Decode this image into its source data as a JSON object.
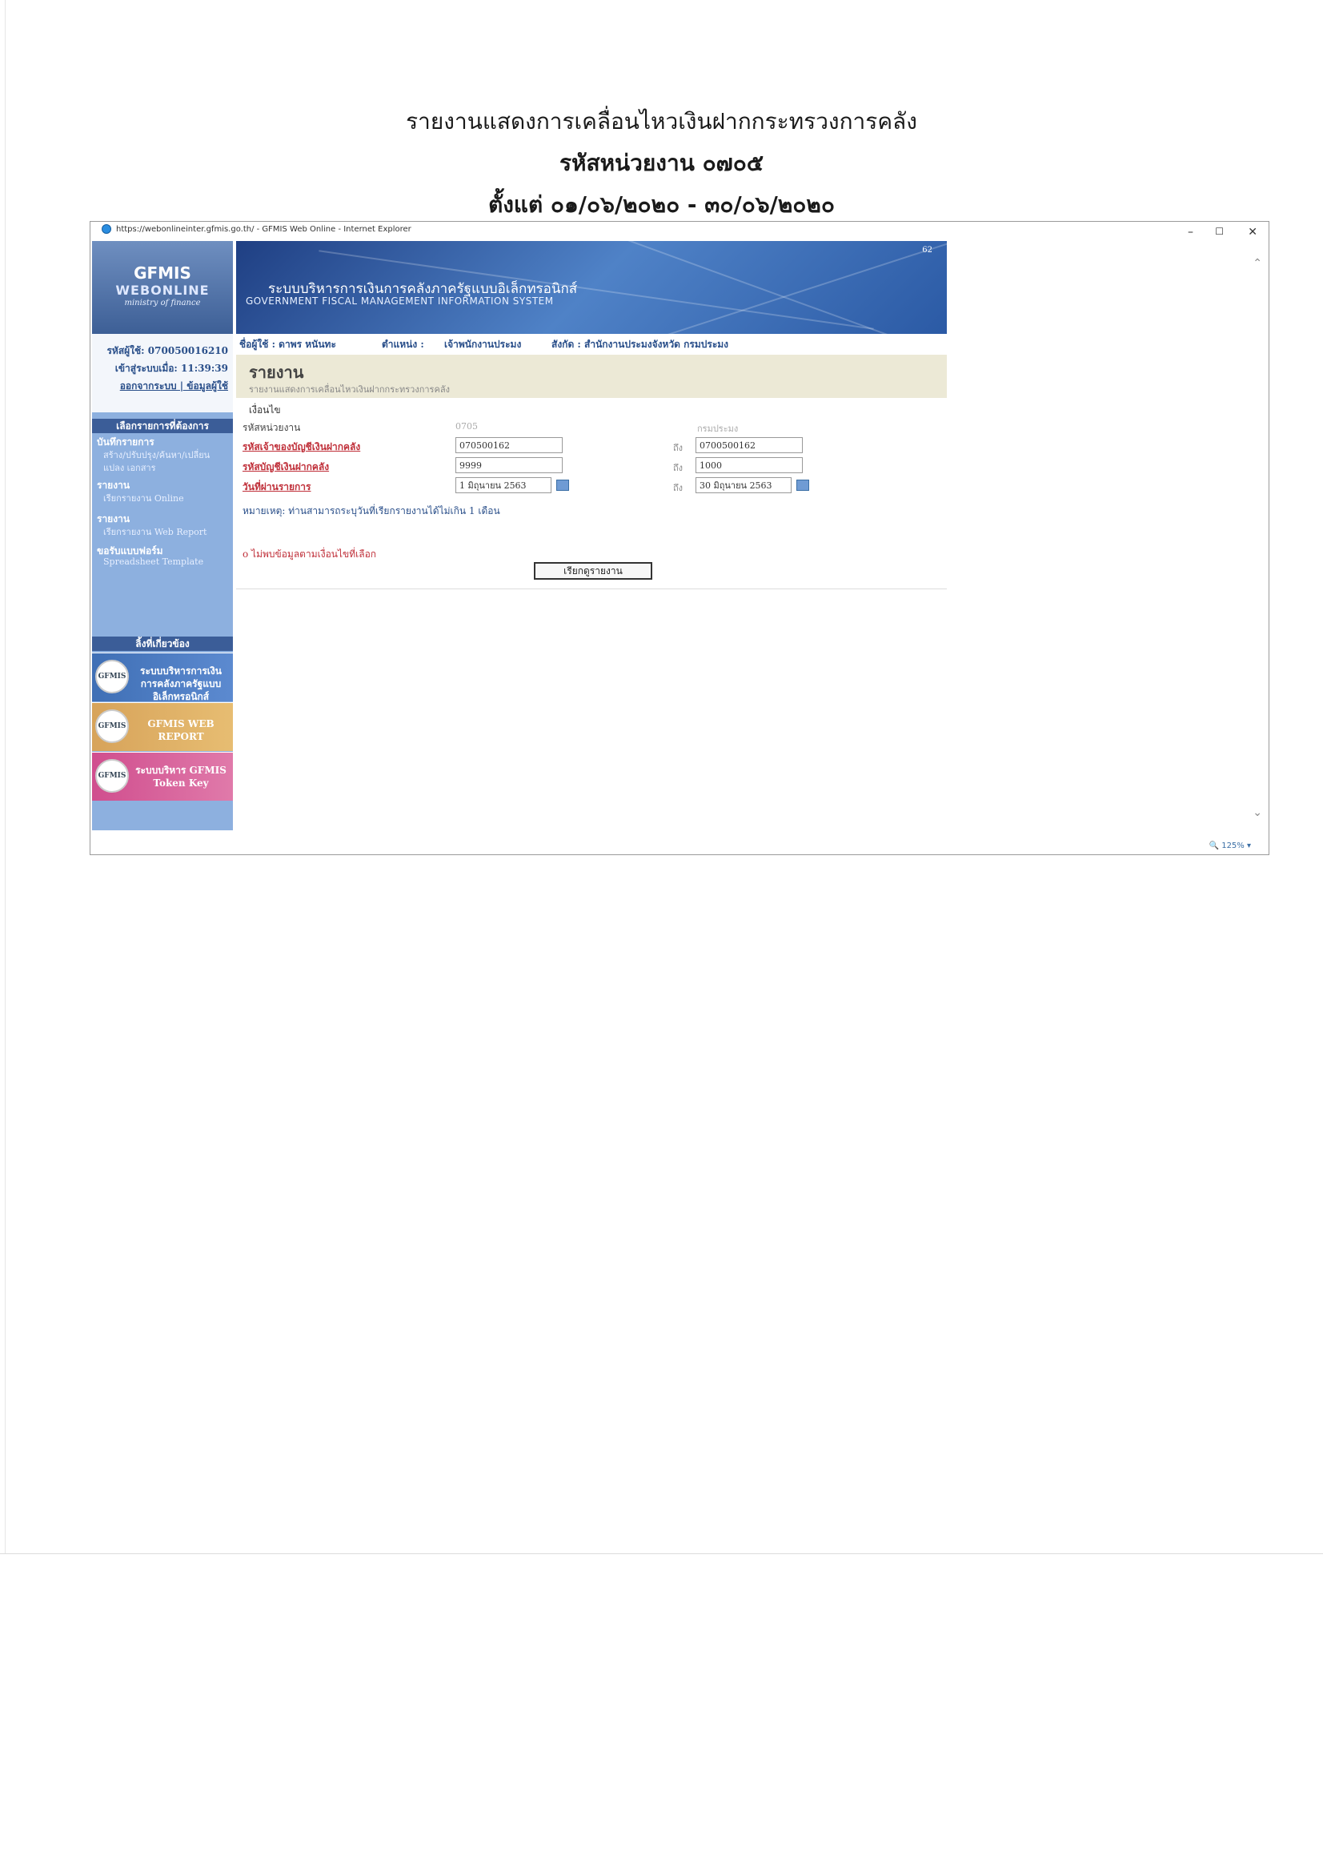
{
  "doc": {
    "title_line1": "รายงานแสดงการเคลื่อนไหวเงินฝากกระทรวงการคลัง",
    "title_line2": "รหัสหน่วยงาน ๐๗๐๕",
    "title_line3": "ตั้งแต่ ๐๑/๐๖/๒๐๒๐ - ๓๐/๐๖/๒๐๒๐"
  },
  "window": {
    "title": "https://webonlineinter.gfmis.go.th/ - GFMIS Web Online - Internet Explorer",
    "minimize": "–",
    "maximize": "☐",
    "close": "✕",
    "zoom": "125%"
  },
  "logo": {
    "title": "GFMIS",
    "subtitle": "WEBONLINE",
    "tagline": "ministry of finance"
  },
  "banner": {
    "thai": "ระบบบริหารการเงินการคลังภาครัฐแบบอิเล็กทรอนิกส์",
    "english": "GOVERNMENT FISCAL MANAGEMENT INFORMATION SYSTEM",
    "code": "62"
  },
  "user": {
    "userid_label": "รหัสผู้ใช้: 070050016210",
    "login_label": "เข้าสู่ระบบเมื่อ: 11:39:39",
    "links": "ออกจากระบบ | ข้อมูลผู้ใช้"
  },
  "infobar": {
    "name": "ชื่อผู้ใช้ : ดาพร หนันทะ",
    "position": "ตำแหน่ง :",
    "position_value": "เจ้าพนักงานประมง",
    "affiliation": "สังกัด : สำนักงานประมงจังหวัด กรมประมง"
  },
  "menu": {
    "header": "เลือกรายการที่ต้องการ",
    "items": [
      {
        "main": "บันทึกรายการ",
        "sub": "สร้าง/ปรับปรุง/ค้นหา/เปลี่ยน"
      },
      {
        "main": "",
        "sub": "แปลง เอกสาร"
      },
      {
        "main": "รายงาน",
        "sub": "เรียกรายงาน Online"
      },
      {
        "main": "รายงาน",
        "sub": "เรียกรายงาน Web Report"
      },
      {
        "main": "ขอรับแบบฟอร์ม",
        "sub": "Spreadsheet Template"
      }
    ],
    "links_header": "ลิ้งที่เกี่ยวข้อง",
    "link1": "ระบบบริหารการเงินการคลังภาครัฐแบบอิเล็กทรอนิกส์",
    "link2": "GFMIS WEB REPORT",
    "link3": "ระบบบริหาร GFMIS Token Key"
  },
  "report": {
    "title": "รายงาน",
    "subtitle": "รายงานแสดงการเคลื่อนไหวเงินฝากกระทรวงการคลัง",
    "conditions_label": "เงื่อนไข",
    "rows": [
      {
        "label": "รหัสหน่วยงาน",
        "from": "0705",
        "to_label": "",
        "to": "กรมประมง"
      },
      {
        "label": "รหัสเจ้าของบัญชีเงินฝากคลัง",
        "from": "070500162",
        "to_label": "ถึง",
        "to": "0700500162"
      },
      {
        "label": "รหัสบัญชีเงินฝากคลัง",
        "from": "9999",
        "to_label": "ถึง",
        "to": "1000"
      },
      {
        "label": "วันที่ผ่านรายการ",
        "from": "1 มิถุนายน 2563",
        "to_label": "ถึง",
        "to": "30 มิถุนายน 2563"
      }
    ],
    "note": "หมายเหตุ: ท่านสามารถระบุวันที่เรียกรายงานได้ไม่เกิน 1 เดือน",
    "warning": "o ไม่พบข้อมูลตามเงื่อนไขที่เลือก",
    "button": "เรียกดูรายงาน"
  }
}
